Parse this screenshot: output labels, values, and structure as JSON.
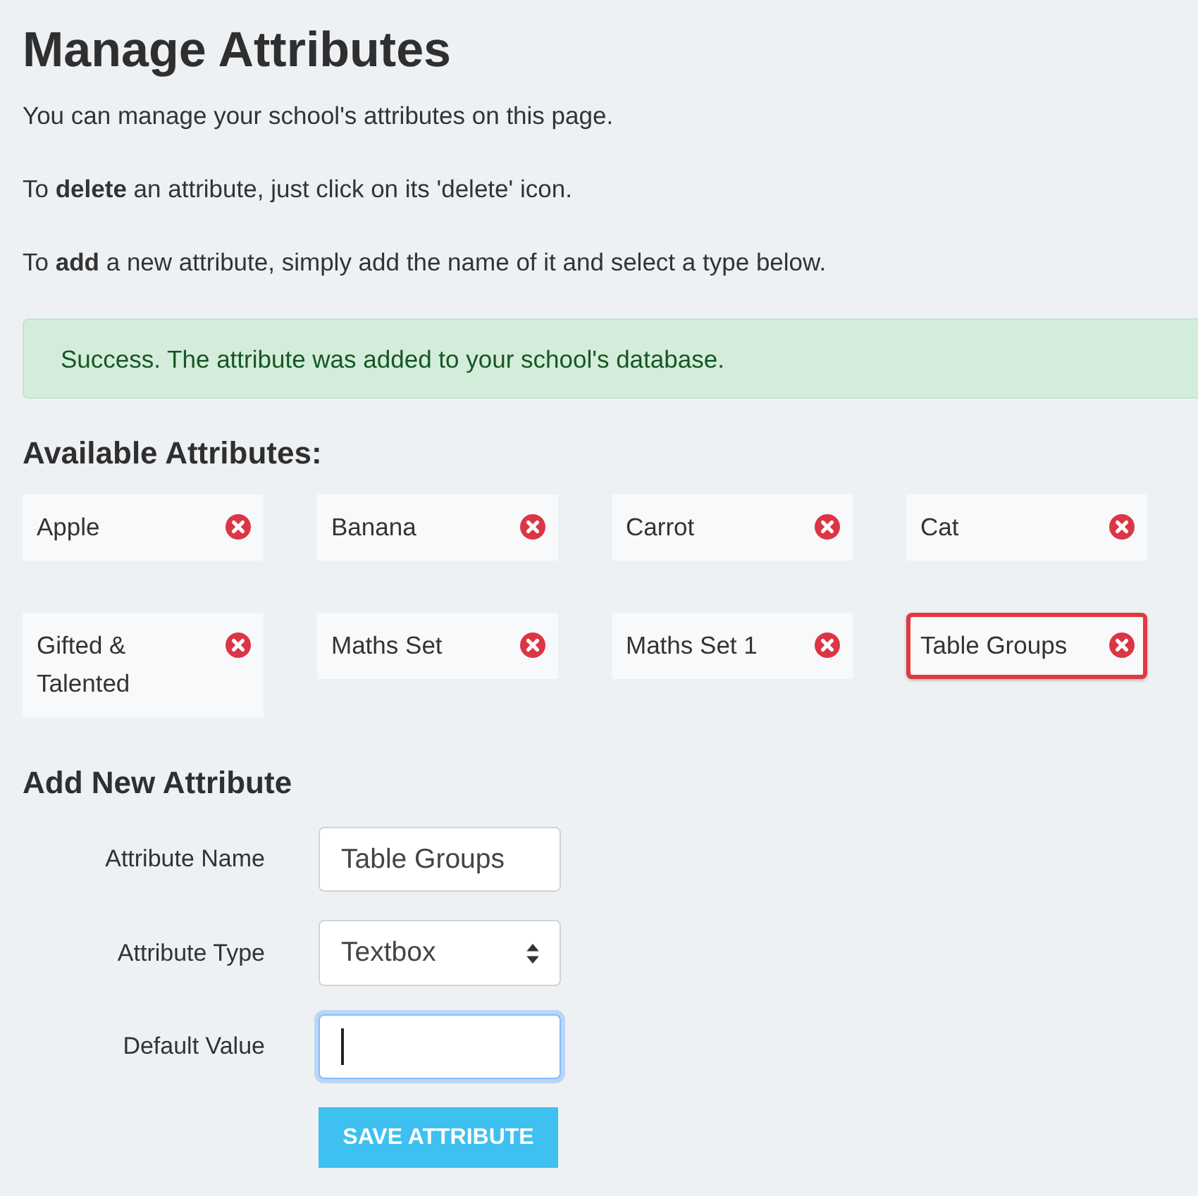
{
  "page": {
    "title": "Manage Attributes",
    "intro": [
      "You can manage your school's attributes on this page.",
      "To **delete** an attribute, just click on its 'delete' icon.",
      "To **add** a new attribute, simply add the name of it and select a type below."
    ]
  },
  "alert": {
    "kind": "success",
    "message": "Success. The attribute was added to your school's database."
  },
  "attributes": {
    "heading": "Available Attributes:",
    "items": [
      {
        "name": "Apple",
        "highlighted": false
      },
      {
        "name": "Banana",
        "highlighted": false
      },
      {
        "name": "Carrot",
        "highlighted": false
      },
      {
        "name": "Cat",
        "highlighted": false
      },
      {
        "name": "Gifted & Talented",
        "highlighted": false
      },
      {
        "name": "Maths Set",
        "highlighted": false
      },
      {
        "name": "Maths Set 1",
        "highlighted": false
      },
      {
        "name": "Table Groups",
        "highlighted": true
      }
    ]
  },
  "form": {
    "heading": "Add New Attribute",
    "fields": [
      {
        "kind": "text",
        "label": "Attribute Name",
        "value": "Table Groups",
        "focused": false
      },
      {
        "kind": "select",
        "label": "Attribute Type",
        "value": "Textbox",
        "focused": false
      },
      {
        "kind": "text",
        "label": "Default Value",
        "focused": true
      }
    ],
    "submit": "SAVE ATTRIBUTE"
  }
}
